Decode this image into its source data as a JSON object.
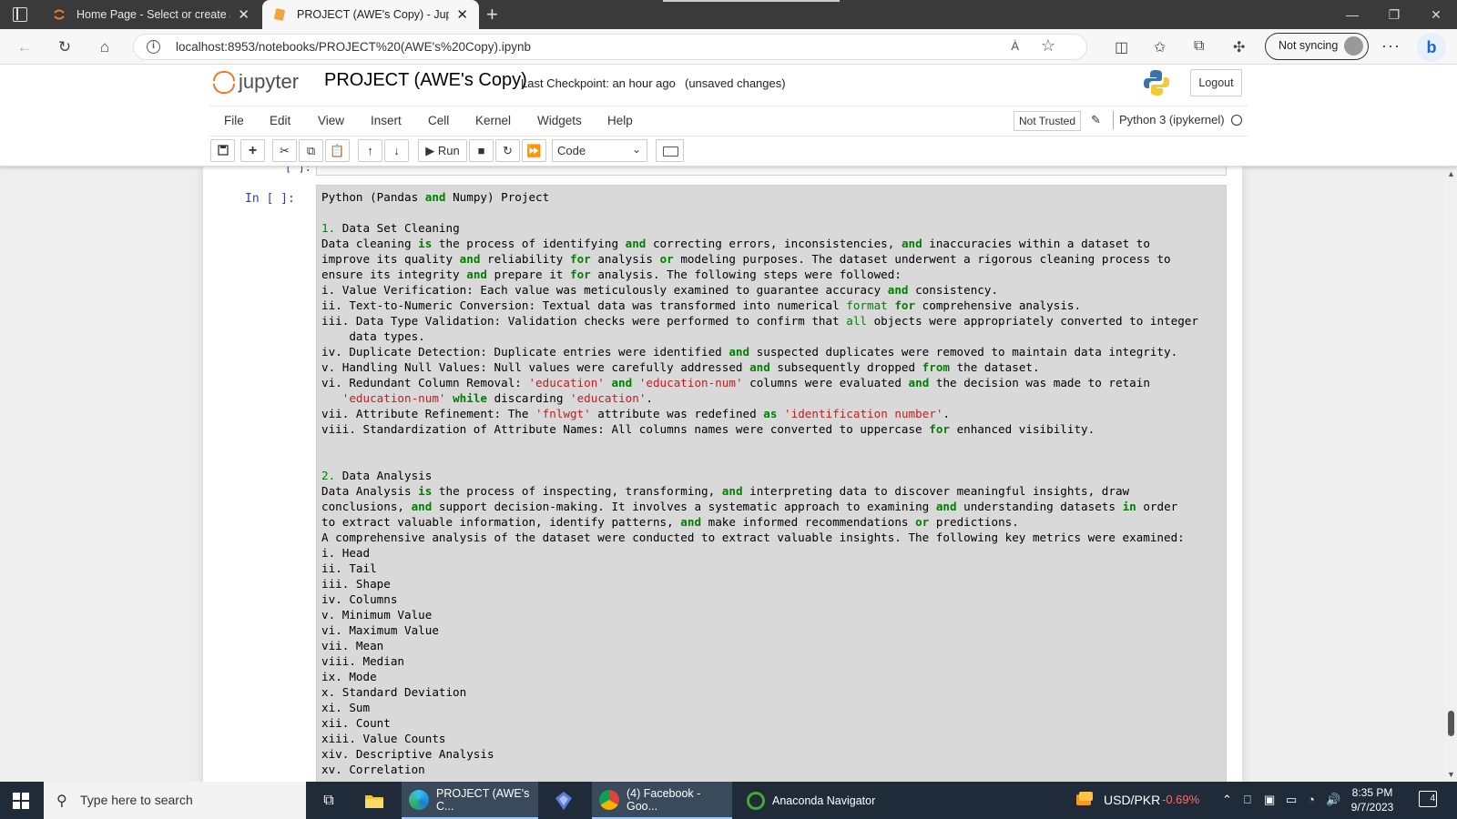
{
  "browser": {
    "tabs": [
      {
        "title": "Home Page - Select or create a n",
        "active": false
      },
      {
        "title": "PROJECT (AWE's Copy) - Jupyter",
        "active": true
      }
    ],
    "new_tab": "+",
    "url": "localhost:8953/notebooks/PROJECT%20(AWE's%20Copy).ipynb",
    "read_aloud": "À",
    "sync_label": "Not syncing",
    "more": "···",
    "bing": "b"
  },
  "jupyter": {
    "logo_text": "jupyter",
    "notebook_name": "PROJECT (AWE's Copy)",
    "checkpoint": "Last Checkpoint: an hour ago",
    "unsaved": "(unsaved changes)",
    "logout": "Logout",
    "menu": [
      "File",
      "Edit",
      "View",
      "Insert",
      "Cell",
      "Kernel",
      "Widgets",
      "Help"
    ],
    "trust": "Not Trusted",
    "kernel": "Python 3 (ipykernel)",
    "toolbar": {
      "run_label": "Run",
      "cell_type": "Code"
    }
  },
  "cell": {
    "prompt": "In [ ]:",
    "prev_prompt": "[ ]:",
    "lines": [
      [
        [
          "t",
          "Python (Pandas "
        ],
        [
          "k",
          "and"
        ],
        [
          "t",
          " Numpy) Project"
        ]
      ],
      [
        [
          "t",
          ""
        ]
      ],
      [
        [
          "n",
          "1."
        ],
        [
          "t",
          " Data Set Cleaning"
        ]
      ],
      [
        [
          "t",
          "Data cleaning "
        ],
        [
          "k",
          "is"
        ],
        [
          "t",
          " the process of identifying "
        ],
        [
          "k",
          "and"
        ],
        [
          "t",
          " correcting errors, inconsistencies, "
        ],
        [
          "k",
          "and"
        ],
        [
          "t",
          " inaccuracies within a dataset to"
        ]
      ],
      [
        [
          "t",
          "improve its quality "
        ],
        [
          "k",
          "and"
        ],
        [
          "t",
          " reliability "
        ],
        [
          "k",
          "for"
        ],
        [
          "t",
          " analysis "
        ],
        [
          "k",
          "or"
        ],
        [
          "t",
          " modeling purposes. The dataset underwent a rigorous cleaning process to"
        ]
      ],
      [
        [
          "t",
          "ensure its integrity "
        ],
        [
          "k",
          "and"
        ],
        [
          "t",
          " prepare it "
        ],
        [
          "k",
          "for"
        ],
        [
          "t",
          " analysis. The following steps were followed:"
        ]
      ],
      [
        [
          "t",
          "i. Value Verification: Each value was meticulously examined to guarantee accuracy "
        ],
        [
          "k",
          "and"
        ],
        [
          "t",
          " consistency."
        ]
      ],
      [
        [
          "t",
          "ii. Text-to-Numeric Conversion: Textual data was transformed into numerical "
        ],
        [
          "f",
          "format"
        ],
        [
          "t",
          " "
        ],
        [
          "k",
          "for"
        ],
        [
          "t",
          " comprehensive analysis."
        ]
      ],
      [
        [
          "t",
          "iii. Data Type Validation: Validation checks were performed to confirm that "
        ],
        [
          "f",
          "all"
        ],
        [
          "t",
          " objects were appropriately converted to integer"
        ]
      ],
      [
        [
          "t",
          "    data types."
        ]
      ],
      [
        [
          "t",
          "iv. Duplicate Detection: Duplicate entries were identified "
        ],
        [
          "k",
          "and"
        ],
        [
          "t",
          " suspected duplicates were removed to maintain data integrity."
        ]
      ],
      [
        [
          "t",
          "v. Handling Null Values: Null values were carefully addressed "
        ],
        [
          "k",
          "and"
        ],
        [
          "t",
          " subsequently dropped "
        ],
        [
          "k",
          "from"
        ],
        [
          "t",
          " the dataset."
        ]
      ],
      [
        [
          "t",
          "vi. Redundant Column Removal: "
        ],
        [
          "s",
          "'education'"
        ],
        [
          "t",
          " "
        ],
        [
          "k",
          "and"
        ],
        [
          "t",
          " "
        ],
        [
          "s",
          "'education-num'"
        ],
        [
          "t",
          " columns were evaluated "
        ],
        [
          "k",
          "and"
        ],
        [
          "t",
          " the decision was made to retain"
        ]
      ],
      [
        [
          "t",
          "   "
        ],
        [
          "s",
          "'education-num'"
        ],
        [
          "t",
          " "
        ],
        [
          "k",
          "while"
        ],
        [
          "t",
          " discarding "
        ],
        [
          "s",
          "'education'"
        ],
        [
          "t",
          "."
        ]
      ],
      [
        [
          "t",
          "vii. Attribute Refinement: The "
        ],
        [
          "s",
          "'fnlwgt'"
        ],
        [
          "t",
          " attribute was redefined "
        ],
        [
          "k",
          "as"
        ],
        [
          "t",
          " "
        ],
        [
          "s",
          "'identification number'"
        ],
        [
          "t",
          "."
        ]
      ],
      [
        [
          "t",
          "viii. Standardization of Attribute Names: All columns names were converted to uppercase "
        ],
        [
          "k",
          "for"
        ],
        [
          "t",
          " enhanced visibility."
        ]
      ],
      [
        [
          "t",
          ""
        ]
      ],
      [
        [
          "t",
          ""
        ]
      ],
      [
        [
          "n",
          "2."
        ],
        [
          "t",
          " Data Analysis"
        ]
      ],
      [
        [
          "t",
          "Data Analysis "
        ],
        [
          "k",
          "is"
        ],
        [
          "t",
          " the process of inspecting, transforming, "
        ],
        [
          "k",
          "and"
        ],
        [
          "t",
          " interpreting data to discover meaningful insights, draw"
        ]
      ],
      [
        [
          "t",
          "conclusions, "
        ],
        [
          "k",
          "and"
        ],
        [
          "t",
          " support decision-making. It involves a systematic approach to examining "
        ],
        [
          "k",
          "and"
        ],
        [
          "t",
          " understanding datasets "
        ],
        [
          "k",
          "in"
        ],
        [
          "t",
          " order"
        ]
      ],
      [
        [
          "t",
          "to extract valuable information, identify patterns, "
        ],
        [
          "k",
          "and"
        ],
        [
          "t",
          " make informed recommendations "
        ],
        [
          "k",
          "or"
        ],
        [
          "t",
          " predictions."
        ]
      ],
      [
        [
          "t",
          "A comprehensive analysis of the dataset were conducted to extract valuable insights. The following key metrics were examined:"
        ]
      ],
      [
        [
          "t",
          "i. Head"
        ]
      ],
      [
        [
          "t",
          "ii. Tail"
        ]
      ],
      [
        [
          "t",
          "iii. Shape"
        ]
      ],
      [
        [
          "t",
          "iv. Columns"
        ]
      ],
      [
        [
          "t",
          "v. Minimum Value"
        ]
      ],
      [
        [
          "t",
          "vi. Maximum Value"
        ]
      ],
      [
        [
          "t",
          "vii. Mean"
        ]
      ],
      [
        [
          "t",
          "viii. Median"
        ]
      ],
      [
        [
          "t",
          "ix. Mode"
        ]
      ],
      [
        [
          "t",
          "x. Standard Deviation"
        ]
      ],
      [
        [
          "t",
          "xi. Sum"
        ]
      ],
      [
        [
          "t",
          "xii. Count"
        ]
      ],
      [
        [
          "t",
          "xiii. Value Counts"
        ]
      ],
      [
        [
          "t",
          "xiv. Descriptive Analysis"
        ]
      ],
      [
        [
          "t",
          "xv. Correlation"
        ]
      ]
    ]
  },
  "taskbar": {
    "search_placeholder": "Type here to search",
    "apps": [
      {
        "label": "PROJECT (AWE's C...",
        "icon": "edge-icon",
        "active": true
      },
      {
        "label": "(4) Facebook - Goo...",
        "icon": "chrome-icon",
        "active": true
      },
      {
        "label": "Anaconda Navigator",
        "icon": "anaconda-icon",
        "active": false
      }
    ],
    "ticker_name": "USD/PKR",
    "ticker_change": "-0.69%",
    "time": "8:35 PM",
    "date": "9/7/2023",
    "notifications": "4"
  },
  "colors": {
    "keyword": "#008000",
    "string": "#ba2121",
    "prompt": "#303f9f",
    "jupyter_orange": "#f37726",
    "ticker_negative": "#ff6b6b"
  }
}
